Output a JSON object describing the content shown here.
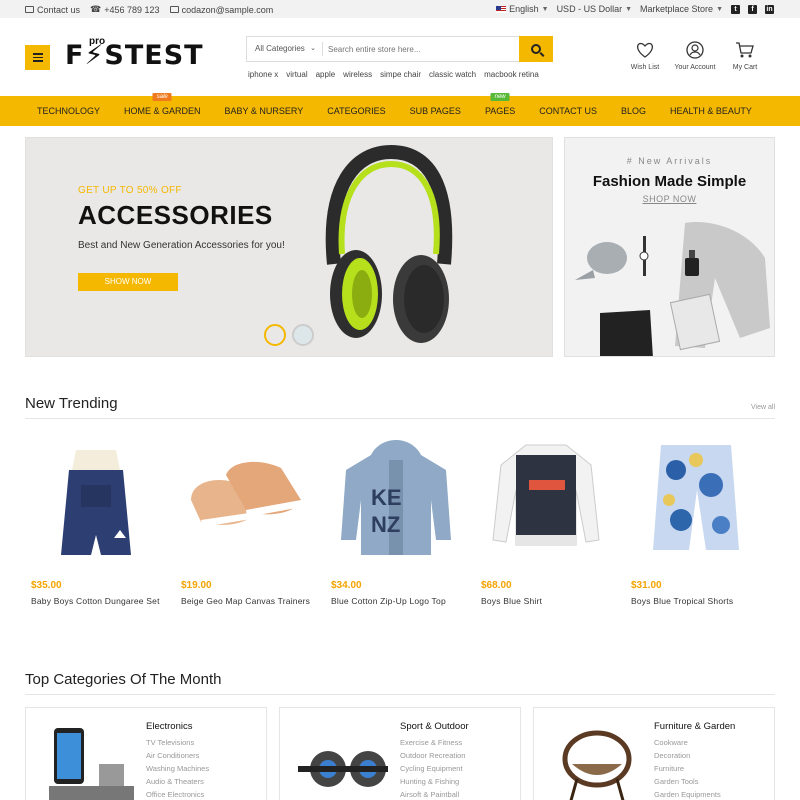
{
  "topbar": {
    "contact": "Contact us",
    "phone": "+456 789 123",
    "email": "codazon@sample.com",
    "language": "English",
    "currency": "USD - US Dollar",
    "store": "Marketplace Store",
    "social": [
      "twitter-icon",
      "facebook-icon",
      "linkedin-icon"
    ]
  },
  "header": {
    "logo_text": "F⚡STEST",
    "logo_pro": "pro",
    "search": {
      "category": "All Categories",
      "placeholder": "Search entire store here..."
    },
    "tags": [
      "iphone x",
      "virtual",
      "apple",
      "wireless",
      "simpe chair",
      "classic watch",
      "macbook retina"
    ],
    "icons": [
      {
        "label": "Wish List",
        "icon": "heart-icon"
      },
      {
        "label": "Your Account",
        "icon": "user-icon"
      },
      {
        "label": "My Cart",
        "icon": "cart-icon"
      }
    ]
  },
  "nav": {
    "items": [
      {
        "label": "TECHNOLOGY",
        "badge": ""
      },
      {
        "label": "HOME & GARDEN",
        "badge": "sale"
      },
      {
        "label": "BABY & NURSERY",
        "badge": ""
      },
      {
        "label": "CATEGORIES",
        "badge": ""
      },
      {
        "label": "SUB PAGES",
        "badge": ""
      },
      {
        "label": "PAGES",
        "badge": "new"
      },
      {
        "label": "CONTACT US",
        "badge": ""
      },
      {
        "label": "BLOG",
        "badge": ""
      },
      {
        "label": "HEALTH & BEAUTY",
        "badge": ""
      }
    ]
  },
  "hero": {
    "subtitle": "GET UP TO 50% OFF",
    "title": "ACCESSORIES",
    "description": "Best and New Generation Accessories for you!",
    "cta": "SHOW NOW"
  },
  "promo": {
    "kicker": "# New Arrivals",
    "title": "Fashion Made Simple",
    "link": "SHOP NOW"
  },
  "trending": {
    "title": "New Trending",
    "view_all": "View all",
    "products": [
      {
        "price": "$35.00",
        "name": "Baby Boys Cotton Dungaree Set"
      },
      {
        "price": "$19.00",
        "name": "Beige Geo Map Canvas Trainers"
      },
      {
        "price": "$34.00",
        "name": "Blue Cotton Zip-Up Logo Top"
      },
      {
        "price": "$68.00",
        "name": "Boys Blue Shirt"
      },
      {
        "price": "$31.00",
        "name": "Boys Blue Tropical Shorts"
      }
    ]
  },
  "categories": {
    "title": "Top Categories Of The Month",
    "cards": [
      {
        "title": "Electronics",
        "items": [
          "TV Televisions",
          "Air Conditioners",
          "Washing Machines",
          "Audio & Theaters",
          "Office Electronics"
        ]
      },
      {
        "title": "Sport & Outdoor",
        "items": [
          "Exercise & Fitness",
          "Outdoor Recreation",
          "Cycling Equipment",
          "Hunting & Fishing",
          "Airsoft & Paintball"
        ]
      },
      {
        "title": "Furniture & Garden",
        "items": [
          "Cookware",
          "Decoration",
          "Furniture",
          "Garden Tools",
          "Garden Equipments"
        ]
      }
    ]
  },
  "colors": {
    "accent": "#f5b800",
    "price": "#f5a300",
    "badge_sale": "#ef7a1e",
    "badge_new": "#58b837"
  }
}
